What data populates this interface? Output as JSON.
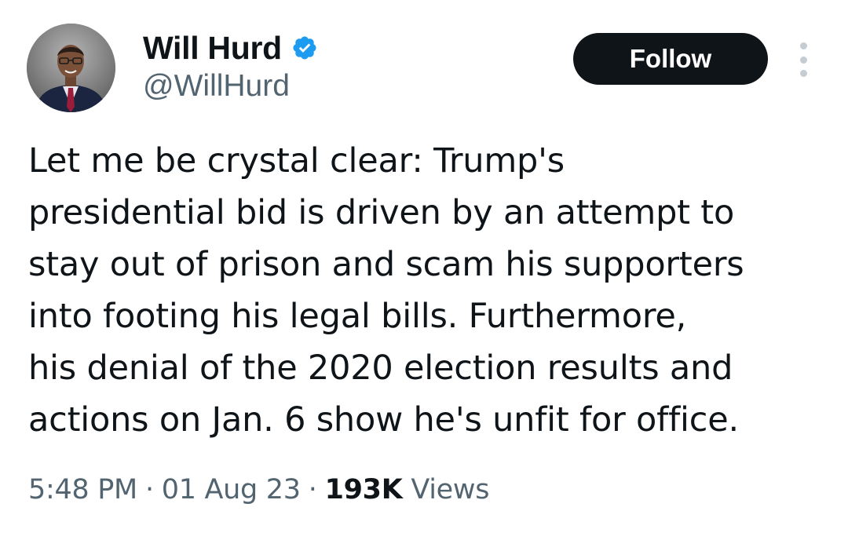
{
  "author": {
    "display_name": "Will Hurd",
    "handle": "@WillHurd",
    "verified": true,
    "verified_color": "#1d9bf0"
  },
  "actions": {
    "follow_label": "Follow",
    "more_icon": "more-vertical-icon"
  },
  "tweet": {
    "lines": [
      "Let me be crystal clear: Trump's",
      "presidential bid is driven by an attempt to",
      "stay out of prison and scam his supporters",
      "into footing his legal bills. Furthermore,",
      "his denial of the 2020 election results and",
      "actions on Jan. 6 show he's unfit for office."
    ]
  },
  "meta": {
    "time": "5:48 PM",
    "separator": "·",
    "date": "01 Aug 23",
    "views_count": "193K",
    "views_label": "Views"
  },
  "colors": {
    "text_primary": "#0f1419",
    "text_secondary": "#536471",
    "button_bg": "#0f1419"
  }
}
